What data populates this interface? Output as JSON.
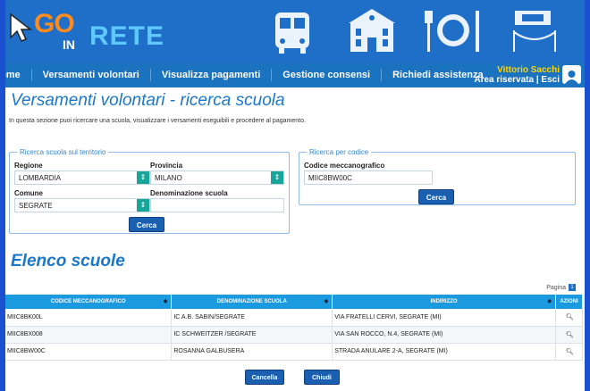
{
  "header": {
    "logo_go": "GO",
    "logo_in": "IN",
    "logo_rete": "RETE"
  },
  "nav": {
    "items": [
      {
        "label": "ome"
      },
      {
        "label": "Versamenti volontari"
      },
      {
        "label": "Visualizza pagamenti"
      },
      {
        "label": "Gestione consensi"
      },
      {
        "label": "Richiedi assistenza"
      }
    ],
    "user_name": "Vittorio Sacchi",
    "user_links": "Area riservata | Esci"
  },
  "page": {
    "title": "Versamenti volontari - ricerca scuola",
    "description": "In questa sezione puoi ricercare una scuola, visualizzare i versamenti eseguibili e procedere al pagamento."
  },
  "territory_search": {
    "legend": "Ricerca scuola sul territorio",
    "regione_label": "Regione",
    "regione_value": "LOMBARDIA",
    "provincia_label": "Provincia",
    "provincia_value": "MILANO",
    "comune_label": "Comune",
    "comune_value": "SEGRATE",
    "denominazione_label": "Denominazione scuola",
    "denominazione_value": "",
    "search_button": "Cerca"
  },
  "code_search": {
    "legend": "Ricerca per codice",
    "codice_label": "Codice meccanografico",
    "codice_value": "MIIC8BW00C",
    "search_button": "Cerca"
  },
  "list": {
    "title": "Elenco scuole",
    "pager_label": "Pagina",
    "pager_page": "1",
    "columns": [
      "Codice meccanografico",
      "Denominazione scuola",
      "Indirizzo",
      "Azioni"
    ],
    "rows": [
      {
        "codice": "MIIC8BK00L",
        "denominazione": "IC A.B. SABIN/SEGRATE",
        "indirizzo": "VIA FRATELLI CERVI, SEGRATE (MI)"
      },
      {
        "codice": "MIIC8BX008",
        "denominazione": "IC SCHWEITZER /SEGRATE",
        "indirizzo": "VIA SAN ROCCO, N.4, SEGRATE (MI)"
      },
      {
        "codice": "MIIC8BW00C",
        "denominazione": "ROSANNA GALBUSERA",
        "indirizzo": "STRADA ANULARE 2-A, SEGRATE (MI)"
      }
    ]
  },
  "footer": {
    "cancel_button": "Cancella",
    "close_button": "Chiudi"
  },
  "colors": {
    "banner": "#1f6fc8",
    "accent": "#1b78c8",
    "table_header": "#1b9ae0",
    "button": "#1a5fb0",
    "user_name": "#ffd400"
  }
}
